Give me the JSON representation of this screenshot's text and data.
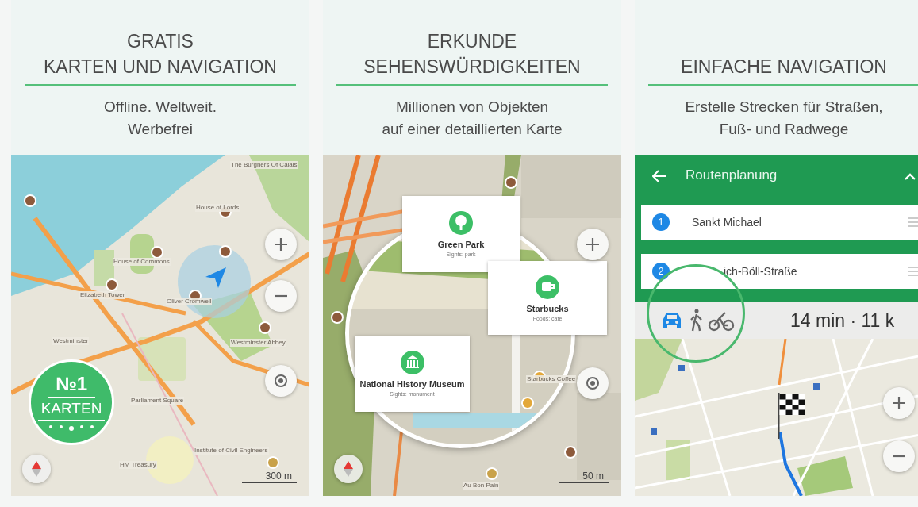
{
  "panels": [
    {
      "kind": "navigation",
      "title_lines": [
        "GRATIS",
        "KARTEN UND NAVIGATION"
      ],
      "subtitle_lines": [
        "Offline. Weltweit.",
        "Werbefrei"
      ],
      "badge": {
        "number": "№1",
        "label": "KARTEN"
      },
      "map_labels": [
        "The Burghers Of Calais",
        "House of Lords",
        "House of Commons",
        "Elizabeth Tower",
        "Oliver Cromwell",
        "Westminster",
        "Westminster Abbey",
        "Parliament Square",
        "HM Treasury",
        "Institute of Civil Engineers"
      ],
      "scale": "300 m"
    },
    {
      "kind": "places",
      "title_lines": [
        "ERKUNDE",
        "SEHENSWÜRDIGKEITEN"
      ],
      "subtitle_lines": [
        "Millionen von Objekten",
        "auf einer detaillierten Karte"
      ],
      "callouts": [
        {
          "kind": "park",
          "name": "Green Park",
          "category": "Sights: park"
        },
        {
          "kind": "cafe",
          "name": "Starbucks",
          "category": "Foods: cafe"
        },
        {
          "kind": "monument",
          "name": "National History Museum",
          "category": "Sights: monument"
        }
      ],
      "map_labels": [
        "Starbucks Coffee",
        "Au Bon Pain"
      ],
      "scale": "50 m"
    },
    {
      "kind": "route",
      "title_lines": [
        "EINFACHE NAVIGATION"
      ],
      "subtitle_lines": [
        "Erstelle Strecken für Straßen,",
        "Fuß- und Radwege"
      ],
      "route_title": "Routenplanung",
      "waypoints": [
        {
          "number": "1",
          "name": "Sankt Michael"
        },
        {
          "number": "2",
          "name": "ich-Böll-Straße"
        }
      ],
      "modes": [
        {
          "kind": "car",
          "selected": true
        },
        {
          "kind": "walk",
          "selected": false
        },
        {
          "kind": "bike",
          "selected": false
        }
      ],
      "summary": "14 min · 11 k"
    }
  ]
}
